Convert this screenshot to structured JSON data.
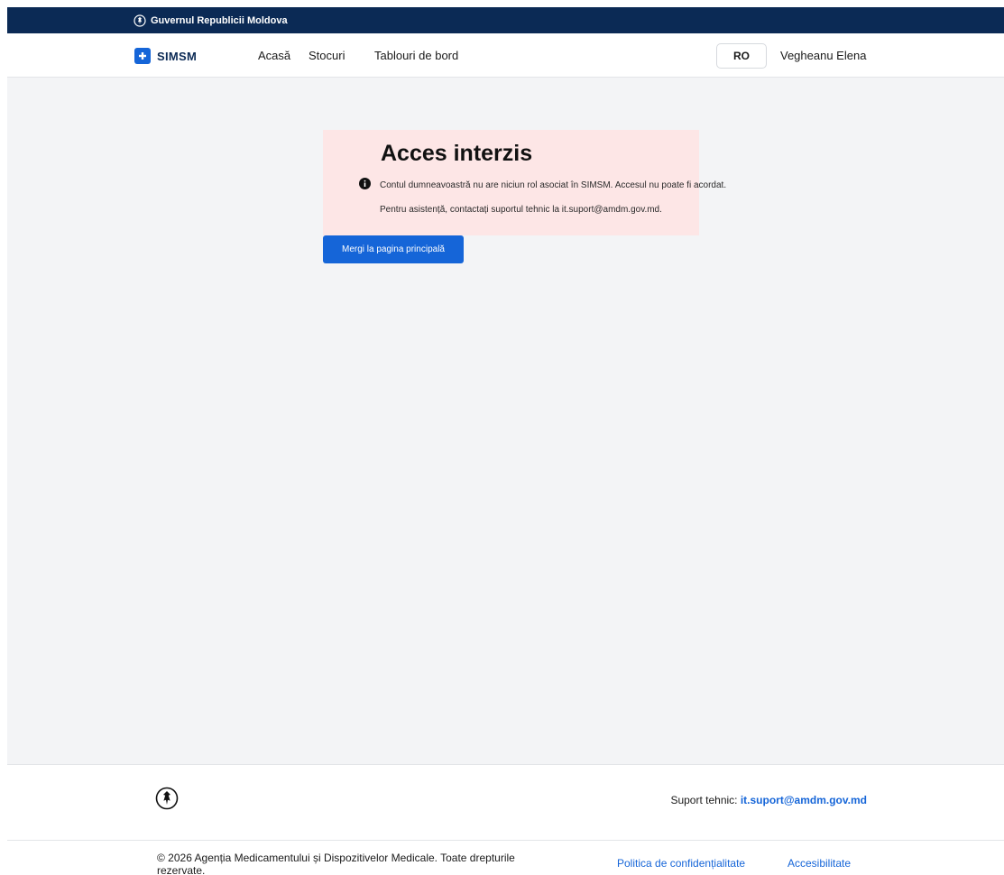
{
  "gov_bar": {
    "label": "Guvernul Republicii Moldova",
    "icon": "moldova-emblem-icon"
  },
  "header": {
    "logo_text": "SIMSM",
    "logo_icon": "plus-cross-icon",
    "nav": {
      "home": "Acasă",
      "stocks": "Stocuri",
      "dashboards": "Tablouri de bord"
    },
    "language": "RO",
    "user_name": "Vegheanu Elena"
  },
  "alert": {
    "title": "Acces interzis",
    "icon": "info-icon",
    "message": "Contul dumneavoastră nu are niciun rol asociat în SIMSM. Accesul nu poate fi acordat.",
    "support_text": "Pentru asistență, contactați suportul tehnic la it.suport@amdm.gov.md."
  },
  "main": {
    "home_button_label": "Mergi la pagina principală"
  },
  "footer": {
    "emblem_icon": "moldova-emblem-icon",
    "support_label": "Suport tehnic:",
    "support_email": "it.suport@amdm.gov.md",
    "copyright": "© 2026 Agenția Medicamentului și Dispozitivelor Medicale. Toate drepturile rezervate.",
    "privacy_link": "Politica de confidențialitate",
    "accessibility_link": "Accesibilitate"
  },
  "colors": {
    "gov_bar_bg": "#0b2a55",
    "accent_blue": "#1565d8",
    "alert_bg": "#fde6e6",
    "main_bg": "#f3f4f6"
  }
}
